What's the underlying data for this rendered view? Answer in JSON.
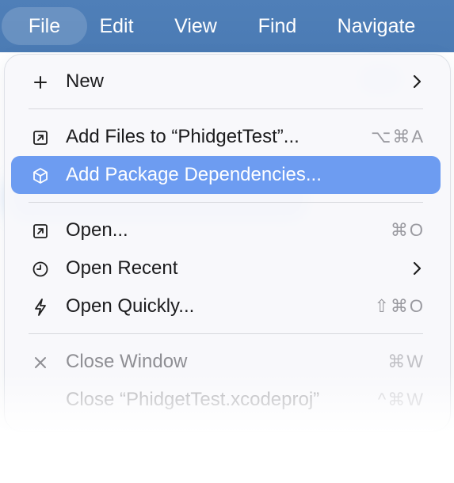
{
  "menubar": {
    "items": [
      "File",
      "Edit",
      "View",
      "Find",
      "Navigate"
    ],
    "active": "File"
  },
  "file_menu": {
    "new": {
      "label": "New",
      "icon": "plus-icon",
      "submenu": true
    },
    "add_files": {
      "label": "Add Files to “PhidgetTest”...",
      "icon": "arrow-box-icon",
      "shortcut": "⌥⌘A"
    },
    "add_package": {
      "label": "Add Package Dependencies...",
      "icon": "package-cube-icon",
      "selected": true
    },
    "open": {
      "label": "Open...",
      "icon": "arrow-box-icon",
      "shortcut": "⌘O"
    },
    "open_recent": {
      "label": "Open Recent",
      "icon": "clock-icon",
      "submenu": true
    },
    "open_quickly": {
      "label": "Open Quickly...",
      "icon": "lightning-icon",
      "shortcut": "⇧⌘O"
    },
    "close_window": {
      "label": "Close Window",
      "icon": "close-x-icon",
      "shortcut": "⌘W",
      "enabled": false
    },
    "close_project": {
      "label": "Close “PhidgetTest.xcodeproj”",
      "shortcut": "^⌘W",
      "enabled": false
    }
  },
  "colors": {
    "menubar": "#4b7bb4",
    "selection": "#6d9cf1",
    "menu_background": "#f7f8fb"
  }
}
